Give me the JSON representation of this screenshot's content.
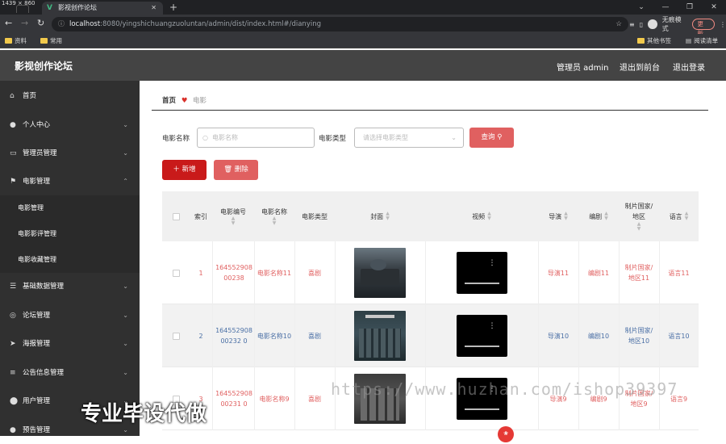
{
  "browser": {
    "window_size_label": "1439 × 860",
    "tab_title": "影视创作论坛",
    "tab_icon": "vue-logo-icon",
    "url_host": "localhost",
    "url_path": ":8080/yingshichuangzuoluntan/admin/dist/index.html#/dianying",
    "incognito_label": "无痕模式",
    "update_label": "更新",
    "bookmarks": [
      "资料",
      "常用"
    ],
    "other_bookmarks": "其他书签",
    "reading_list": "阅读清单"
  },
  "header": {
    "brand": "影视创作论坛",
    "admin_label": "管理员 admin",
    "back_label": "退出到前台",
    "logout_label": "退出登录"
  },
  "sidebar": {
    "items": [
      {
        "label": "首页",
        "icon": "home-icon"
      },
      {
        "label": "个人中心",
        "icon": "user-icon"
      },
      {
        "label": "管理员管理",
        "icon": "chat-icon"
      },
      {
        "label": "电影管理",
        "icon": "flag-icon"
      },
      {
        "label": "基础数据管理",
        "icon": "list-icon"
      },
      {
        "label": "论坛管理",
        "icon": "globe-icon"
      },
      {
        "label": "海报管理",
        "icon": "send-icon"
      },
      {
        "label": "公告信息管理",
        "icon": "sliders-icon"
      },
      {
        "label": "用户管理",
        "icon": "pin-icon"
      },
      {
        "label": "预告管理",
        "icon": "user-icon"
      }
    ],
    "sub_items": [
      "电影管理",
      "电影影评管理",
      "电影收藏管理"
    ]
  },
  "breadcrumb": {
    "home": "首页",
    "current": "电影"
  },
  "filters": {
    "name_label": "电影名称",
    "name_placeholder": "电影名称",
    "type_label": "电影类型",
    "type_placeholder": "请选择电影类型",
    "search_label": "查询"
  },
  "actions": {
    "add_label": "新增",
    "delete_label": "删除"
  },
  "table": {
    "headers": [
      "索引",
      "电影编号",
      "电影名称",
      "电影类型",
      "封面",
      "视频",
      "导演",
      "编剧",
      "制片国家/地区",
      "语言"
    ],
    "rows": [
      {
        "index": "1",
        "code": "16455290800238",
        "name": "电影名称11",
        "type": "喜剧",
        "director": "导演11",
        "writer": "编剧11",
        "country": "制片国家/地区11",
        "language": "语言11",
        "color": "#e06060"
      },
      {
        "index": "2",
        "code": "16455290800232 0",
        "name": "电影名称10",
        "type": "喜剧",
        "director": "导演10",
        "writer": "编剧10",
        "country": "制片国家/地区10",
        "language": "语言10",
        "color": "#4a6fa5"
      },
      {
        "index": "3",
        "code": "16455290800231 0",
        "name": "电影名称9",
        "type": "喜剧",
        "director": "导演9",
        "writer": "编剧9",
        "country": "制片国家/地区9",
        "language": "语言9",
        "color": "#e06060"
      }
    ]
  },
  "watermarks": {
    "url_text": "https://www.huzhan.com/ishop39397",
    "cn_text": "专业毕设代做"
  }
}
